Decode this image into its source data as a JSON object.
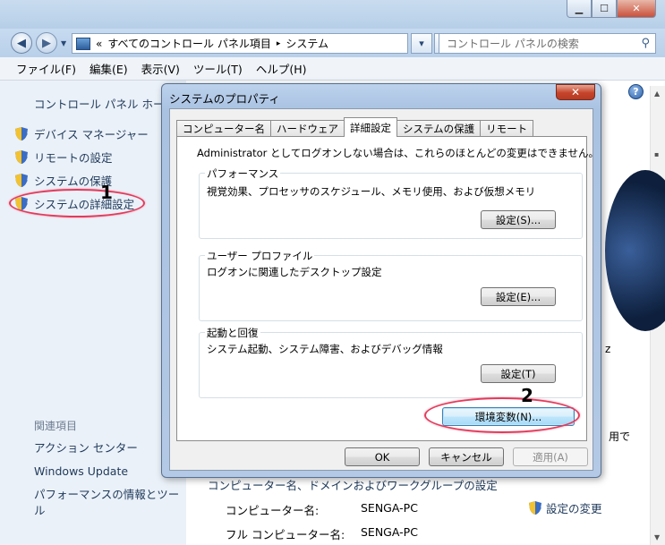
{
  "explorer": {
    "address": {
      "chevron": "«",
      "crumb1": "すべてのコントロール パネル項目",
      "sep": "▸",
      "crumb2": "システム"
    },
    "search_placeholder": "コントロール パネルの検索",
    "menu": [
      "ファイル(F)",
      "編集(E)",
      "表示(V)",
      "ツール(T)",
      "ヘルプ(H)"
    ]
  },
  "leftpane": {
    "home": "コントロール パネル ホーム",
    "links": [
      "デバイス マネージャー",
      "リモートの設定",
      "システムの保護",
      "システムの詳細設定"
    ],
    "related_title": "関連項目",
    "related": [
      "アクション センター",
      "Windows Update",
      "パフォーマンスの情報とツール"
    ]
  },
  "content": {
    "edge_text_1": "z",
    "edge_text_2": "用で",
    "computer_section_title": "コンピューター名、ドメインおよびワークグループの設定",
    "rows": [
      {
        "label": "コンピューター名:",
        "value": "SENGA-PC"
      },
      {
        "label": "フル コンピューター名:",
        "value": "SENGA-PC"
      }
    ],
    "change_link": "設定の変更"
  },
  "dialog": {
    "title": "システムのプロパティ",
    "close": "✕",
    "tabs": [
      "コンピューター名",
      "ハードウェア",
      "詳細設定",
      "システムの保護",
      "リモート"
    ],
    "active_tab": "詳細設定",
    "notice": "Administrator としてログオンしない場合は、これらのほとんどの変更はできません。",
    "groups": [
      {
        "title": "パフォーマンス",
        "desc": "視覚効果、プロセッサのスケジュール、メモリ使用、および仮想メモリ",
        "button": "設定(S)..."
      },
      {
        "title": "ユーザー プロファイル",
        "desc": "ログオンに関連したデスクトップ設定",
        "button": "設定(E)..."
      },
      {
        "title": "起動と回復",
        "desc": "システム起動、システム障害、およびデバッグ情報",
        "button": "設定(T)"
      }
    ],
    "env_button": "環境変数(N)...",
    "ok": "OK",
    "cancel": "キャンセル",
    "apply": "適用(A)"
  },
  "annotations": {
    "one": "1",
    "two": "2",
    "color": "#e23b5c"
  }
}
